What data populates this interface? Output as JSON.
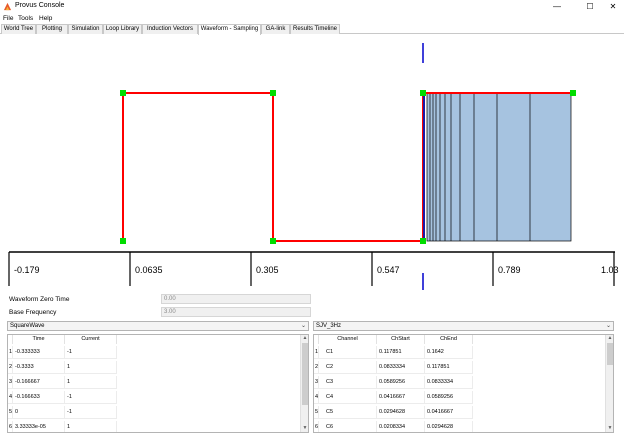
{
  "window": {
    "title": "Provus Console",
    "minimize": "—",
    "maximize": "☐",
    "close": "✕"
  },
  "menu": [
    "File",
    "Tools",
    "Help"
  ],
  "tabs": [
    {
      "label": "World Tree",
      "active": false
    },
    {
      "label": "Plotting",
      "active": false
    },
    {
      "label": "Simulation",
      "active": false
    },
    {
      "label": "Loop Library",
      "active": false
    },
    {
      "label": "Induction Vectors",
      "active": false
    },
    {
      "label": "Waveform - Sampling",
      "active": true
    },
    {
      "label": "GA-link",
      "active": false
    },
    {
      "label": "Results Timeline",
      "active": false
    }
  ],
  "axis": {
    "ticks": [
      "-0.179",
      "0.0635",
      "0.305",
      "0.547",
      "0.789",
      "1.03"
    ]
  },
  "form": {
    "zero_time_label": "Waveform Zero Time",
    "zero_time_value": "0.00",
    "base_freq_label": "Base Frequency",
    "base_freq_value": "3.00"
  },
  "waveform_select": {
    "value": "SquareWave"
  },
  "channel_select": {
    "value": "SJV_3Hz"
  },
  "waveform_table": {
    "headers": [
      "Time",
      "Current"
    ],
    "rows": [
      {
        "num": "1",
        "time": "-0.333333",
        "current": "-1"
      },
      {
        "num": "2",
        "time": "-0.3333",
        "current": "1"
      },
      {
        "num": "3",
        "time": "-0.166667",
        "current": "1"
      },
      {
        "num": "4",
        "time": "-0.166633",
        "current": "-1"
      },
      {
        "num": "5",
        "time": "0",
        "current": "-1"
      },
      {
        "num": "6",
        "time": "3.33333e-05",
        "current": "1"
      }
    ]
  },
  "channel_table": {
    "headers": [
      "Channel",
      "ChStart",
      "ChEnd"
    ],
    "rows": [
      {
        "num": "1",
        "channel": "C1",
        "start": "0.117851",
        "end": "0.1642"
      },
      {
        "num": "2",
        "channel": "C2",
        "start": "0.0833334",
        "end": "0.117851"
      },
      {
        "num": "3",
        "channel": "C3",
        "start": "0.0589256",
        "end": "0.0833334"
      },
      {
        "num": "4",
        "channel": "C4",
        "start": "0.0416667",
        "end": "0.0589256"
      },
      {
        "num": "5",
        "channel": "C5",
        "start": "0.0294628",
        "end": "0.0416667"
      },
      {
        "num": "6",
        "channel": "C6",
        "start": "0.0208334",
        "end": "0.0294628"
      }
    ]
  },
  "colors": {
    "waveform_line": "#ff0000",
    "vertex": "#00dd00",
    "channel_fill": "#a6c3e0",
    "marker": "#0000cc"
  }
}
